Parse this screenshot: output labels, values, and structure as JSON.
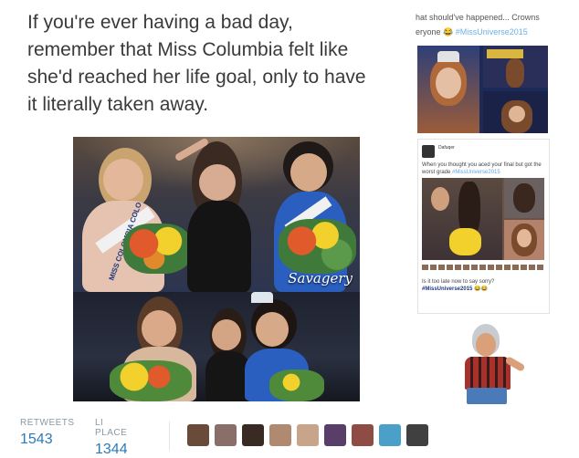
{
  "tweet": {
    "line1": "If you're ever having a bad day,",
    "line2": "remember that Miss Columbia felt like",
    "line3": "she'd reached her life goal, only to have",
    "line4": "it literally taken away."
  },
  "photo": {
    "watermark": "Savagery",
    "sash_text": "MISS COLOMBIA COLO"
  },
  "right_panel": {
    "line1": "hat should've happened... Crowns",
    "line2_prefix": "eryone ",
    "line2_emoji": "😂",
    "line2_hashtag": "#MissUniverse2015",
    "embed": {
      "name": "Dafuqer",
      "message": "When you thought you aced your final but got the worst grade ",
      "message_hashtag": "#MissUniverse2015",
      "late_text": "Is it too late now to say sorry?",
      "late_hashtag": "#MissUniverse2015 😂😂"
    }
  },
  "stats": {
    "retweets_label": "RETWEETS",
    "retweets_value": "1543",
    "likes_label": "LI PLACE",
    "likes_value": "1344"
  },
  "colors": {
    "link": "#2b7bb9",
    "label": "#8899a6"
  }
}
